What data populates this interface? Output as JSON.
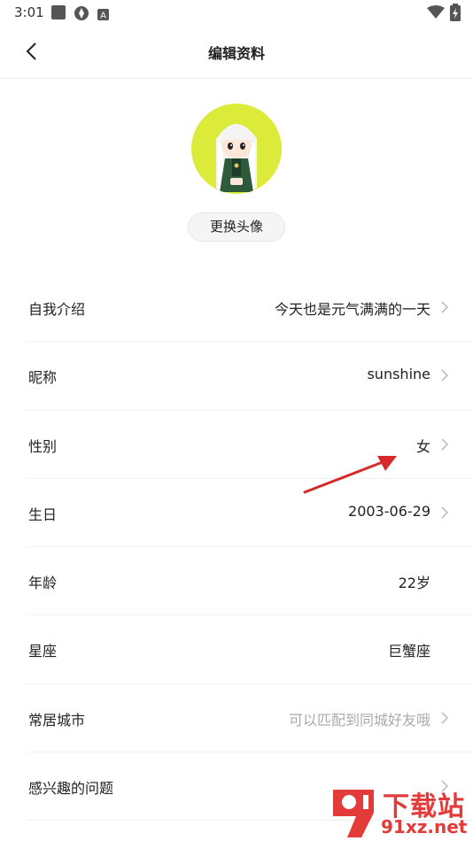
{
  "status_bar": {
    "time": "3:01"
  },
  "header": {
    "title": "编辑资料"
  },
  "profile": {
    "change_avatar_label": "更换头像"
  },
  "rows": [
    {
      "label": "自我介绍",
      "value": "今天也是元气满满的一天",
      "chevron": true,
      "placeholder": false
    },
    {
      "label": "昵称",
      "value": "sunshine",
      "chevron": true,
      "placeholder": false
    },
    {
      "label": "性别",
      "value": "女",
      "chevron": true,
      "placeholder": false
    },
    {
      "label": "生日",
      "value": "2003-06-29",
      "chevron": true,
      "placeholder": false
    },
    {
      "label": "年龄",
      "value": "22岁",
      "chevron": false,
      "placeholder": false
    },
    {
      "label": "星座",
      "value": "巨蟹座",
      "chevron": false,
      "placeholder": false
    },
    {
      "label": "常居城市",
      "value": "可以匹配到同城好友哦",
      "chevron": true,
      "placeholder": true
    },
    {
      "label": "感兴趣的问题",
      "value": "",
      "chevron": true,
      "placeholder": false
    }
  ],
  "watermark": {
    "title": "下载站",
    "url": "91xz.net"
  },
  "colors": {
    "avatar_bg": "#dcea3a",
    "annotation_arrow": "#d42a2a",
    "watermark": "#e33a3a"
  }
}
